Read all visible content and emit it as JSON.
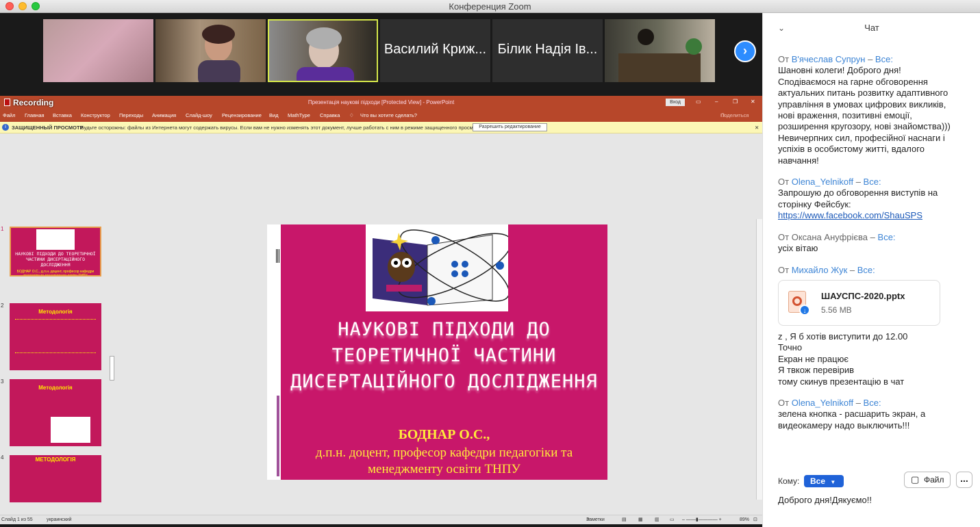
{
  "window": {
    "title": "Конференция Zoom"
  },
  "colors": {
    "zoom_blue": "#2d8cff",
    "ppt_red": "#b7472a",
    "slide_pink": "#c8176a",
    "slide_yellow": "#ffeb3b",
    "link_blue": "#3c84d5"
  },
  "gallery": {
    "tiles": [
      {
        "name": ""
      },
      {
        "name": ""
      },
      {
        "name": ""
      },
      {
        "name": "Василий Криж..."
      },
      {
        "name": "Білик Надія Ів..."
      },
      {
        "name": ""
      }
    ],
    "next_icon": "chevron-right-icon"
  },
  "ppt": {
    "recording": "Recording",
    "doc_title": "Презентація наукові підходи [Protected View] - PowerPoint",
    "signin": "Вход",
    "share": "Поделиться",
    "menu": [
      "Файл",
      "Главная",
      "Вставка",
      "Конструктор",
      "Переходы",
      "Анимация",
      "Слайд-шоу",
      "Рецензирование",
      "Вид",
      "MathType",
      "Справка"
    ],
    "search": "Что вы хотите сделать?",
    "warning_title": "ЗАЩИЩЕННЫЙ ПРОСМОТР",
    "warning_text": "Будьте осторожны: файлы из Интернета могут содержать вирусы. Если вам не нужно изменять этот документ, лучше работать с ним в режиме защищенного просмотра.",
    "enable_editing": "Разрешить редактирование",
    "thumbnails": [
      {
        "num": "1",
        "title": "НАУКОВІ ПІДХОДИ ДО ТЕОРЕТИЧНОЇ ЧАСТИНИ ДИСЕРТАЦІЙНОГО ДОСЛІДЖЕННЯ",
        "sub": "БОДНАР О.С., д.п.н. доцент, професор кафедри педагогіки та менеджменту освіти ТНПУ"
      },
      {
        "num": "2",
        "title": "Методологія",
        "sub": ""
      },
      {
        "num": "3",
        "title": "Методологія",
        "sub": ""
      },
      {
        "num": "4",
        "title": "МЕТОДОЛОГІЯ",
        "sub": ""
      }
    ],
    "slide": {
      "title_lines": [
        "НАУКОВІ ПІДХОДИ ДО",
        "ТЕОРЕТИЧНОЇ ЧАСТИНИ",
        "ДИСЕРТАЦІЙНОГО ДОСЛІДЖЕННЯ"
      ],
      "author": "БОДНАР О.С.,",
      "affiliation_lines": [
        "д.п.н. доцент, професор кафедри педагогіки та",
        "менеджменту освіти ТНПУ"
      ]
    },
    "status": {
      "slide": "Слайд 1 из 55",
      "lang": "украинский",
      "notes": "Заметки",
      "zoom": "89%"
    }
  },
  "chat": {
    "title": "Чат",
    "messages": [
      {
        "from_prefix": "От",
        "sender": "В'ячеслав Супрун",
        "sep": "–",
        "to": "Все:",
        "lines": [
          "Шановні колеги! Доброго дня!",
          "Сподіваємося на гарне обговорення",
          "актуальних питань розвитку адаптивного",
          "управління в умовах цифрових викликів,",
          "нові враження, позитивні емоції,",
          "розширення кругозору, нові знайомства)))",
          "Невичерпних сил, професійної наснаги і",
          "успіхів в особистому житті, вдалого",
          "навчання!"
        ]
      },
      {
        "from_prefix": "От",
        "sender": "Olena_Yelnikoff",
        "sep": "–",
        "to": "Все:",
        "lines": [
          "Запрошую до обговорення виступів на",
          "сторінку Фейсбук:"
        ],
        "link": "https://www.facebook.com/ShauSPS"
      },
      {
        "from_prefix": "От",
        "sender": "Оксана Ануфрієва",
        "sep": "–",
        "to": "Все:",
        "lines": [
          "усіх вітаю"
        ]
      },
      {
        "from_prefix": "От",
        "sender": "Михайло Жук",
        "sep": "–",
        "to": "Все:",
        "file": {
          "name": "ШАУСПС-2020.pptx",
          "size": "5.56 MB"
        },
        "lines": [
          "z , Я б хотів виступити до 12.00",
          "Точно",
          "Екран не працює",
          "Я твкож перевірив",
          "тому скинув презентацію в чат"
        ]
      },
      {
        "from_prefix": "От",
        "sender": "Olena_Yelnikoff",
        "sep": "–",
        "to": "Все:",
        "lines": [
          "зелена кнопка - расшарить экран, а",
          "видеокамеру надо выключить!!!"
        ]
      }
    ],
    "to_label": "Кому:",
    "recipient": "Все",
    "file_button": "Файл",
    "more_button": "...",
    "input_value": "Доброго дня!Дякуємо!!"
  }
}
